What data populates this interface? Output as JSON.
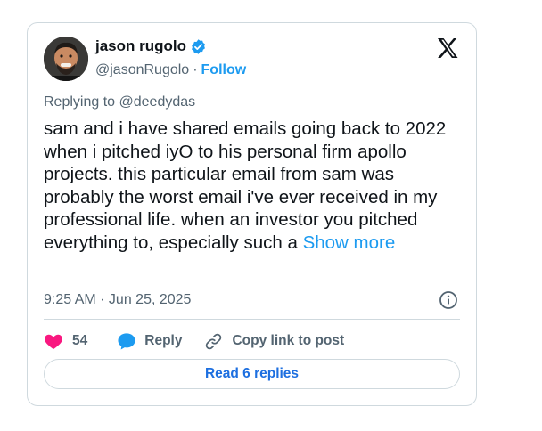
{
  "author": {
    "name": "jason rugolo",
    "handle": "@jasonRugolo",
    "separator": "·",
    "follow_label": "Follow"
  },
  "replying": {
    "prefix": "Replying to",
    "to": "@deedydas"
  },
  "tweet": {
    "text": "sam and i have shared emails going back to 2022 when i pitched iyO to his personal firm apollo projects.  this particular email from sam was probably the worst email i've ever received in my professional life.  when an investor you pitched everything to, especially such a ",
    "show_more": "Show more",
    "timestamp": "9:25 AM · Jun 25, 2025"
  },
  "actions": {
    "likes": "54",
    "reply_label": "Reply",
    "copy_label": "Copy link to post"
  },
  "read_replies_label": "Read 6 replies",
  "colors": {
    "accent": "#1d9bf0",
    "heart": "#f91880",
    "border": "#cfd9de",
    "muted": "#536471"
  },
  "icons": [
    "avatar",
    "verified-badge-icon",
    "x-logo-icon",
    "info-icon",
    "heart-icon",
    "reply-bubble-icon",
    "link-icon"
  ]
}
